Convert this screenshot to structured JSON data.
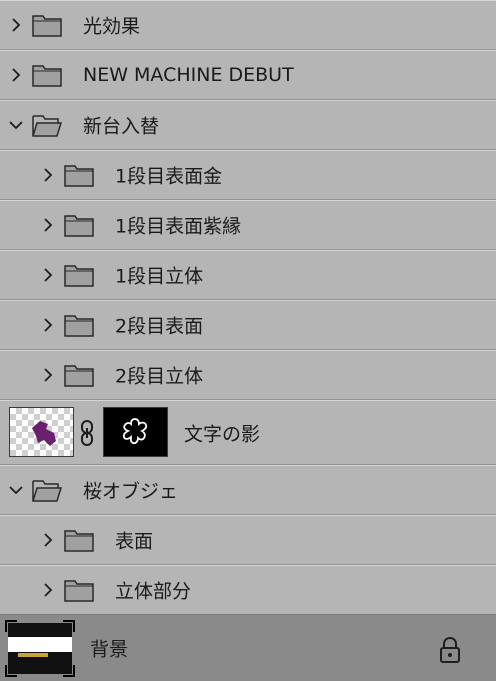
{
  "layers": {
    "rows": [
      {
        "label": "光効果",
        "expanded": false
      },
      {
        "label": "NEW MACHINE DEBUT",
        "expanded": false
      },
      {
        "label": "新台入替",
        "expanded": true
      },
      {
        "label": "1段目表面金",
        "expanded": false
      },
      {
        "label": "1段目表面紫縁",
        "expanded": false
      },
      {
        "label": "1段目立体",
        "expanded": false
      },
      {
        "label": "2段目表面",
        "expanded": false
      },
      {
        "label": "2段目立体",
        "expanded": false
      }
    ],
    "masked_layer": {
      "label": "文字の影",
      "thumb_color": "#6b1f6e"
    },
    "rows2": [
      {
        "label": "桜オブジェ",
        "expanded": true
      },
      {
        "label": "表面",
        "expanded": false
      },
      {
        "label": "立体部分",
        "expanded": false
      }
    ],
    "background": {
      "label": "背景",
      "locked": true
    }
  },
  "icons": {
    "chevron_right": "chevron-right-icon",
    "chevron_down": "chevron-down-icon",
    "folder": "folder-icon",
    "link": "link-icon",
    "lock": "lock-icon"
  },
  "colors": {
    "panel_bg": "#b5b5b5",
    "selected_bg": "#8a8a8a",
    "text": "#1a1a1a"
  }
}
